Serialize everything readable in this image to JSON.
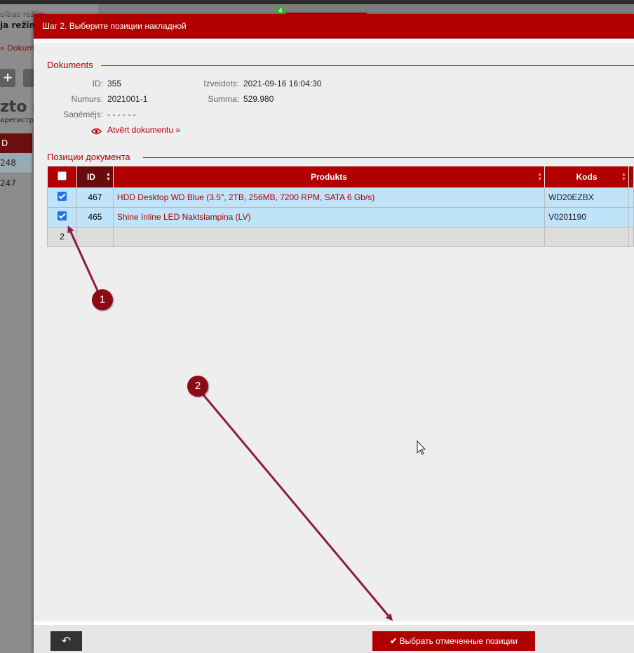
{
  "background": {
    "mode_line1": "oības režīm",
    "mode_line2": "ja režīm",
    "breadcrumb": "»  Dokum",
    "add_label": "+",
    "title_fragment": "zto s",
    "subtitle_fragment": "арегистри",
    "col_fragment": "D",
    "rows": [
      "248",
      "247"
    ],
    "badge": "4"
  },
  "modal": {
    "title": "Шаг 2. Выберите позиции накладной",
    "document_legend": "Dokuments",
    "fields": {
      "id_label": "ID:",
      "id_value": "355",
      "number_label": "Numurs:",
      "number_value": "2021001-1",
      "receiver_label": "Saņēmējs:",
      "receiver_value": "- - - - - -",
      "created_label": "Izveidots:",
      "created_value": "2021-09-16 16:04:30",
      "sum_label": "Summa:",
      "sum_value": "529.980"
    },
    "open_document_link": "Atvērt dokumentu »",
    "positions_legend": "Позиции документа",
    "table": {
      "headers": {
        "id": "ID",
        "product": "Produkts",
        "code": "Kods"
      },
      "rows": [
        {
          "checked": true,
          "id": "467",
          "product": "HDD Desktop WD Blue (3.5\", 2TB, 256MB, 7200 RPM, SATA 6 Gb/s)",
          "code": "WD20EZBX"
        },
        {
          "checked": true,
          "id": "465",
          "product": "Shine Inline LED Naktslampiņa (LV)",
          "code": "V0201190"
        }
      ],
      "footer_count": "2"
    },
    "footer": {
      "back_label": "↶",
      "submit_label": "Выбрать отмеченные позиции"
    }
  },
  "annotations": {
    "marker1": "1",
    "marker2": "2"
  },
  "colors": {
    "brand": "#b00000",
    "selected_row": "#bfe3f9",
    "marker": "#8b0a14",
    "arrow": "#8b1a4a"
  }
}
